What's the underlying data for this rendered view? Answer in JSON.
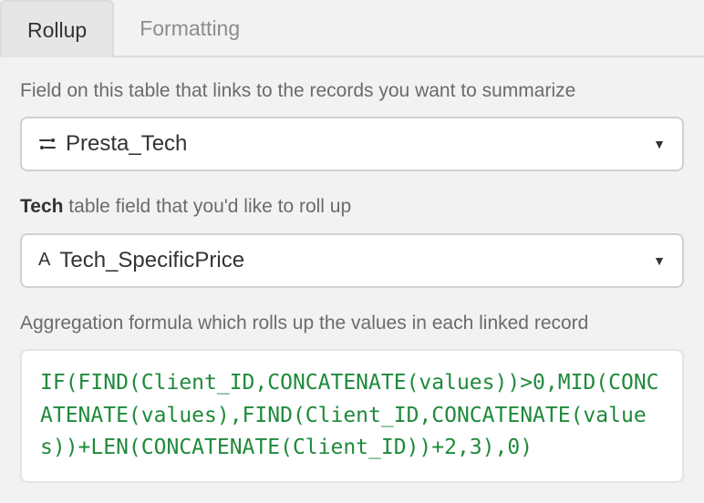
{
  "tabs": {
    "rollup": "Rollup",
    "formatting": "Formatting"
  },
  "labels": {
    "linkField": "Field on this table that links to the records you want to summarize",
    "tableName": "Tech",
    "rollupField_rest": " table field that you'd like to roll up",
    "aggregation": "Aggregation formula which rolls up the values in each linked record"
  },
  "select1": {
    "value": "Presta_Tech"
  },
  "select2": {
    "value": "Tech_SpecificPrice"
  },
  "formula": "IF(FIND(Client_ID,CONCATENATE(values))>0,MID(CONCATENATE(values),FIND(Client_ID,CONCATENATE(values))+LEN(CONCATENATE(Client_ID))+2,3),0)"
}
